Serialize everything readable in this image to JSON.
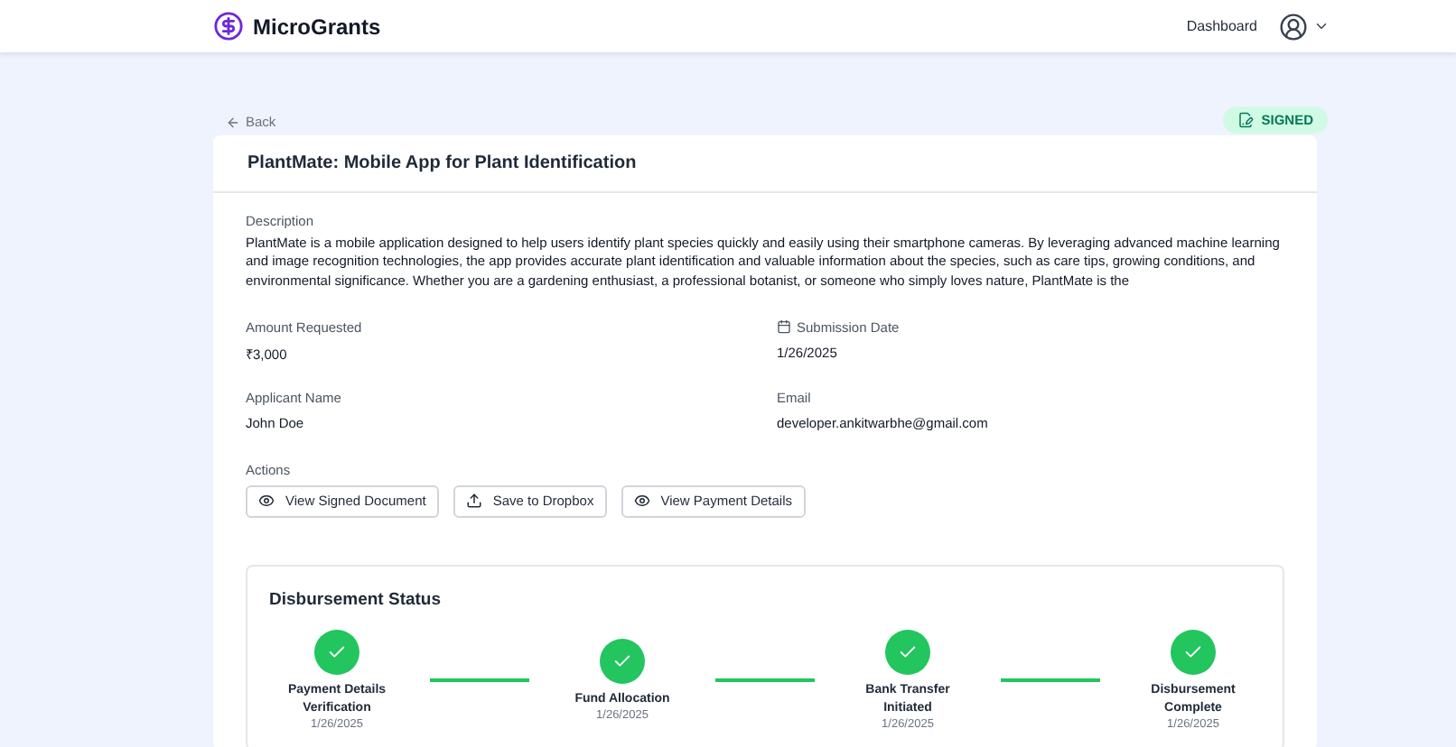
{
  "header": {
    "brand": "MicroGrants",
    "nav_link": "Dashboard"
  },
  "back": "Back",
  "status_badge": "SIGNED",
  "grant": {
    "title": "PlantMate: Mobile App for Plant Identification",
    "description_label": "Description",
    "description": "PlantMate is a mobile application designed to help users identify plant species quickly and easily using their smartphone cameras. By leveraging advanced machine learning and image recognition technologies, the app provides accurate plant identification and valuable information about the species, such as care tips, growing conditions, and environmental significance. Whether you are a gardening enthusiast, a professional botanist, or someone who simply loves nature, PlantMate is the",
    "fields": [
      {
        "label": "Amount Requested",
        "value": "₹3,000",
        "kind": "plain"
      },
      {
        "label": "Submission Date",
        "value": "1/26/2025",
        "kind": "date"
      },
      {
        "label": "Applicant Name",
        "value": "John Doe",
        "kind": "plain"
      },
      {
        "label": "Email",
        "value": "developer.ankitwarbhe@gmail.com",
        "kind": "plain"
      }
    ],
    "actions_label": "Actions",
    "actions": [
      {
        "label": "View Signed Document",
        "kind": "view"
      },
      {
        "label": "Save to Dropbox",
        "kind": "upload"
      },
      {
        "label": "View Payment Details",
        "kind": "view"
      }
    ]
  },
  "disbursement": {
    "title": "Disbursement Status",
    "steps": [
      {
        "label": "Payment Details Verification",
        "date": "1/26/2025",
        "done": true
      },
      {
        "label": "Fund Allocation",
        "date": "1/26/2025",
        "done": true
      },
      {
        "label": "Bank Transfer Initiated",
        "date": "1/26/2025",
        "done": true
      },
      {
        "label": "Disbursement Complete",
        "date": "1/26/2025",
        "done": true
      }
    ]
  }
}
